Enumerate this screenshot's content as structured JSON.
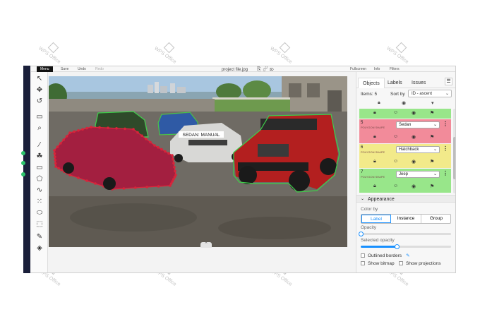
{
  "topbar": {
    "menu": "Menu",
    "save": "Save",
    "undo": "Undo",
    "redo": "Redo",
    "fullscreen": "Fullscreen",
    "info": "Info",
    "filters": "Filters"
  },
  "file": {
    "name": "project file.jpg"
  },
  "canvas": {
    "label_text": "SEDAN: MANUAL"
  },
  "panel": {
    "tabs": [
      "Objects",
      "Labels",
      "Issues"
    ],
    "items_label": "Items: 5",
    "sort_by_label": "Sort by",
    "sort_value": "ID - ascent",
    "objects": [
      {
        "id": "5",
        "shape": "POLYGON SHAPE",
        "label": "Sedan",
        "color": "#f28b9a"
      },
      {
        "id": "6",
        "shape": "POLYGON SHAPE",
        "label": "Hatchback",
        "color": "#f2ea8a"
      },
      {
        "id": "7",
        "shape": "POLYGON SHAPE",
        "label": "Jeep",
        "color": "#98e68a"
      }
    ],
    "top_partial_color": "#98e68a",
    "appearance": {
      "title": "Appearance",
      "color_by_label": "Color by",
      "color_by_options": [
        "Label",
        "Instance",
        "Group"
      ],
      "color_by_selected": "Label",
      "opacity_label": "Opacity",
      "opacity_value": 0.0,
      "selected_opacity_label": "Selected opacity",
      "selected_opacity_value": 0.4,
      "outlined_borders_label": "Outlined borders",
      "show_bitmap_label": "Show bitmap",
      "show_projections_label": "Show projections"
    }
  },
  "watermark": {
    "text": "WPS Office"
  },
  "colors": {
    "accent": "#1890ff",
    "red_object": "#f28b9a",
    "yellow_object": "#f2ea8a",
    "green_object": "#98e68a",
    "polygon_red": "#d8243a",
    "polygon_green": "#3ecf4a"
  }
}
